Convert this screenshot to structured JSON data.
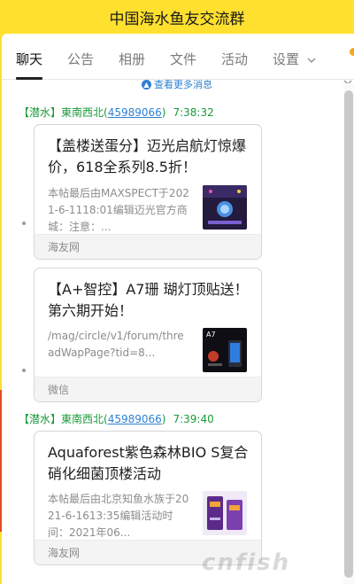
{
  "window": {
    "title": "中国海水鱼友交流群"
  },
  "tabs": [
    {
      "label": "聊天",
      "active": true
    },
    {
      "label": "公告"
    },
    {
      "label": "相册"
    },
    {
      "label": "文件"
    },
    {
      "label": "活动"
    },
    {
      "label": "设置"
    }
  ],
  "chat": {
    "more_link": "查看更多消息",
    "groups": [
      {
        "role": "【潜水】",
        "name": "東南西北",
        "qq": "45989066",
        "time": "7:38:32",
        "cards": [
          {
            "title": "【盖楼送蛋分】迈光启航灯惊爆价，618全系列8.5折！",
            "desc": "本帖最后由MAXSPECT于2021-6-1118:01编辑迈光官方商城：注意：...",
            "source": "海友网"
          },
          {
            "title": "【A+智控】A7珊 瑚灯顶贴送！第六期开始！",
            "desc": "/mag/circle/v1/forum/threadWapPage?tid=8...",
            "source": "微信"
          }
        ]
      },
      {
        "role": "【潜水】",
        "name": "東南西北",
        "qq": "45989066",
        "time": "7:39:40",
        "cards": [
          {
            "title": "Aquaforest紫色森林BIO S复合硝化细菌顶楼活动",
            "desc": "本帖最后由北京知鱼水族于2021-6-1613:35编辑活动时间：2021年06...",
            "source": "海友网"
          }
        ]
      }
    ]
  },
  "watermark": "cnfish"
}
